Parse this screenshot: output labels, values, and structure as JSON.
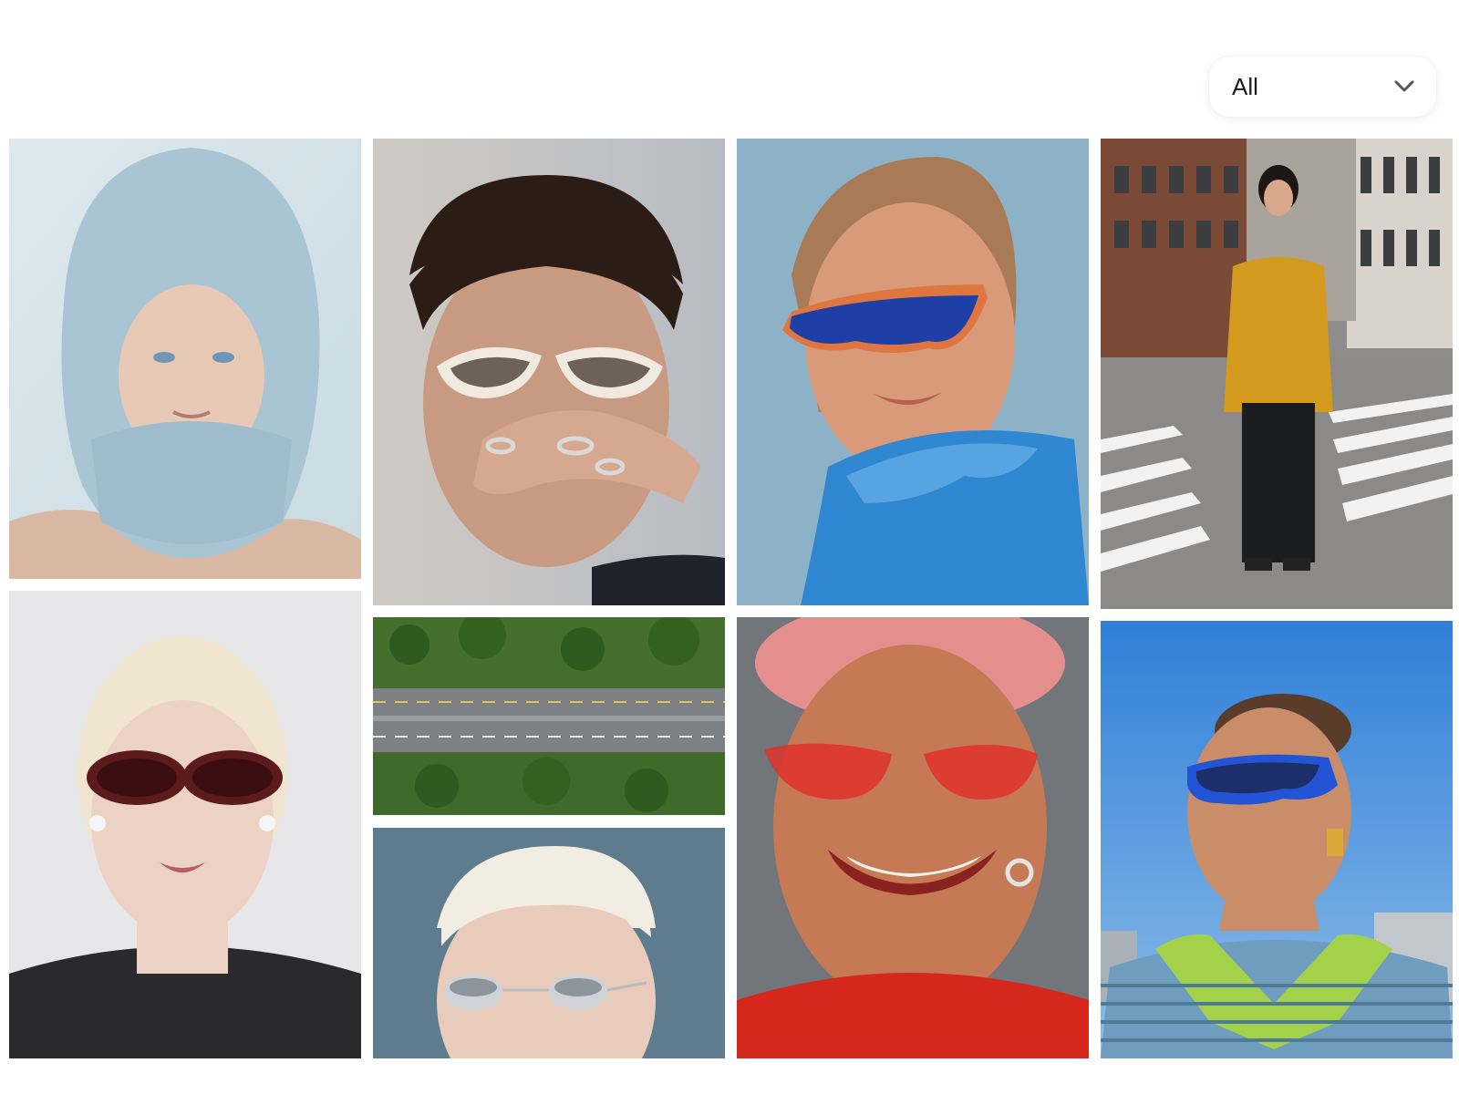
{
  "filter": {
    "selected_label": "All",
    "icon": "chevron-down-icon"
  },
  "gallery": {
    "items": [
      {
        "subject": "knit-balaclava-portrait",
        "bg": "#d5e3e9"
      },
      {
        "subject": "cat-eye-sunglasses-rings-portrait",
        "bg": "#c9c6c1"
      },
      {
        "subject": "blue-shield-sunglasses-portrait",
        "bg": "#8fb0c6"
      },
      {
        "subject": "street-crosswalk-yellow-jacket",
        "bg": "#b8b6b2"
      },
      {
        "subject": "oval-red-sunglasses-portrait",
        "bg": "#e6e6e8"
      },
      {
        "subject": "aerial-highway-forest",
        "bg": "#3d6a2a"
      },
      {
        "subject": "smiling-red-tinted-glasses-portrait",
        "bg": "#7d7f85"
      },
      {
        "subject": "blue-square-sunglasses-sky-portrait",
        "bg": "#3b8ee0"
      },
      {
        "subject": "chrome-oval-sunglasses-portrait",
        "bg": "#5f7b8e"
      }
    ]
  }
}
